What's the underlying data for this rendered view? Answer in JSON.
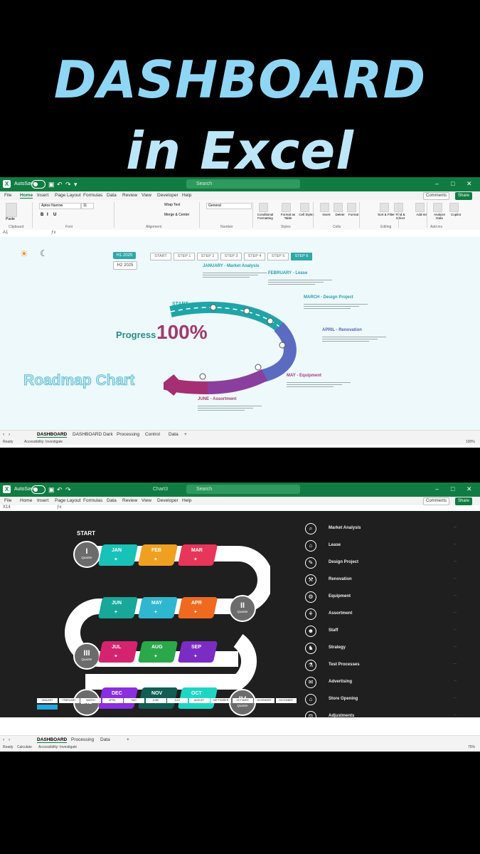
{
  "headline": {
    "line1": "DASHBOARD",
    "line2": "in Excel"
  },
  "excel": {
    "autosave": "AutoSave",
    "toggle": "Off",
    "search": "Search",
    "doc2": "Chart3",
    "comments": "Comments",
    "share": "Share",
    "menu": [
      "File",
      "Home",
      "Insert",
      "Page Layout",
      "Formulas",
      "Data",
      "Review",
      "View",
      "Developer",
      "Help"
    ],
    "ribbon": {
      "font_name": "Aptos Narrow",
      "font_size": "11",
      "wrap": "Wrap Text",
      "merge": "Merge & Center",
      "number_format": "General",
      "groups": [
        "Clipboard",
        "Font",
        "Alignment",
        "Number",
        "Styles",
        "Cells",
        "Editing",
        "Add-ins"
      ],
      "buttons": [
        "Paste",
        "Conditional Formatting",
        "Format as Table",
        "Cell Styles",
        "Insert",
        "Delete",
        "Format",
        "Sort & Filter",
        "Find & Select",
        "Add-ins",
        "Analyze Data",
        "Copilot"
      ]
    }
  },
  "window1": {
    "cell_ref": "A1",
    "h1": "H1 2025",
    "h2": "H2 2025",
    "steps": [
      "START",
      "STEP 1",
      "STEP 2",
      "STEP 3",
      "STEP 4",
      "STEP 5",
      "STEP 6"
    ],
    "progress_label": "Progress",
    "progress_value": "100%",
    "chart_title": "Roadmap Chart",
    "start_label": "START",
    "milestones": [
      {
        "title": "JANUARY - Market Analysis",
        "color": "#2a9bb0"
      },
      {
        "title": "FEBRUARY - Lease",
        "color": "#2a9bb0"
      },
      {
        "title": "MARCH - Design Project",
        "color": "#2a9bb0"
      },
      {
        "title": "APRIL - Renovation",
        "color": "#5566b8"
      },
      {
        "title": "MAY - Equipment",
        "color": "#a23a8c"
      },
      {
        "title": "JUNE - Assortment",
        "color": "#a23a6c"
      }
    ],
    "tabs": [
      "DASHBOARD",
      "DASHBOARD Dark",
      "Processing",
      "Control",
      "Data",
      "+"
    ],
    "status": {
      "ready": "Ready",
      "access": "Accessibility: Investigate",
      "zoom": "100%"
    },
    "colors": {
      "teal": "#1fa5a8",
      "blue": "#5a6bc0",
      "purple": "#8a3f9e",
      "magenta": "#a52f73"
    }
  },
  "window2": {
    "cell_ref": "X14",
    "start": "START",
    "end": "END",
    "quarters": [
      {
        "num": "I",
        "label": "Quarter"
      },
      {
        "num": "II",
        "label": "Quarter"
      },
      {
        "num": "III",
        "label": "Quarter"
      },
      {
        "num": "IV",
        "label": "Quarter"
      }
    ],
    "months_row1": [
      {
        "m": "JAN",
        "c": "#19c2b8"
      },
      {
        "m": "FEB",
        "c": "#f0a020"
      },
      {
        "m": "MAR",
        "c": "#e8355a"
      }
    ],
    "months_row2": [
      {
        "m": "JUN",
        "c": "#17a89a"
      },
      {
        "m": "MAY",
        "c": "#2fb7cf"
      },
      {
        "m": "APR",
        "c": "#ef6a1e"
      }
    ],
    "months_row3": [
      {
        "m": "JUL",
        "c": "#d4246f"
      },
      {
        "m": "AUG",
        "c": "#2aa84a"
      },
      {
        "m": "SEP",
        "c": "#7b2cc4"
      }
    ],
    "months_row4": [
      {
        "m": "DEC",
        "c": "#8a2ee0"
      },
      {
        "m": "NOV",
        "c": "#115e55"
      },
      {
        "m": "OCT",
        "c": "#1ed6c4"
      }
    ],
    "legend": [
      "Market Analysis",
      "Lease",
      "Design Project",
      "Renovation",
      "Equipment",
      "Assortment",
      "Staff",
      "Strategy",
      "Test Processes",
      "Advertising",
      "Store Opening",
      "Adjustments"
    ],
    "legend_icons": [
      "⌕",
      "⌂",
      "✎",
      "⚒",
      "⚙",
      "⚘",
      "☻",
      "♞",
      "⚗",
      "✉",
      "⌂",
      "⚖"
    ],
    "stepcells": [
      "JANUARY",
      "FEBRUARY",
      "MARCH",
      "APRIL",
      "MAY",
      "JUNE",
      "JULY",
      "AUGUST",
      "SEPTEMBER",
      "OCTOBER",
      "NOVEMBER",
      "DECEMBER"
    ],
    "tabs": [
      "DASHBOARD",
      "Processing",
      "Data",
      "+"
    ],
    "status": {
      "ready": "Ready",
      "calc": "Calculate",
      "access": "Accessibility: Investigate",
      "zoom": "75%"
    }
  }
}
